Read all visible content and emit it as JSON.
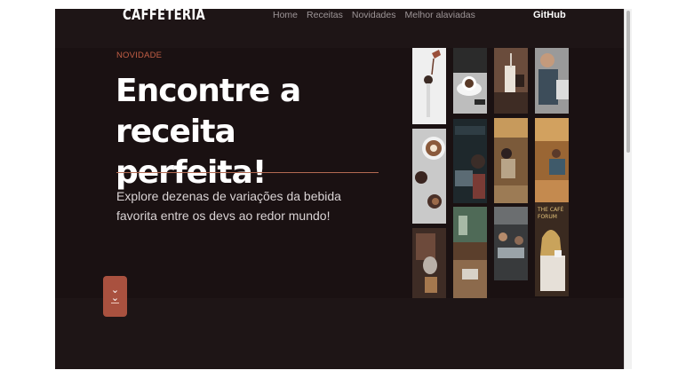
{
  "header": {
    "logo": "CAFFETERIA",
    "nav": [
      "Home",
      "Receitas",
      "Novidades",
      "Melhor alaviadas"
    ],
    "github": "GitHub"
  },
  "hero": {
    "kicker": "NOVIDADE",
    "headline": "Encontre a receita perfeita!",
    "description": "Explore dezenas de variações da bebida favorita entre os devs ao redor mundo!",
    "scroll_icon": "double-chevron-down-icon"
  },
  "gallery": {
    "sign_text": "THE CAFÉ FORUM"
  },
  "colors": {
    "background": "#1a1112",
    "accent": "#c25e45",
    "button": "#a9513f"
  }
}
